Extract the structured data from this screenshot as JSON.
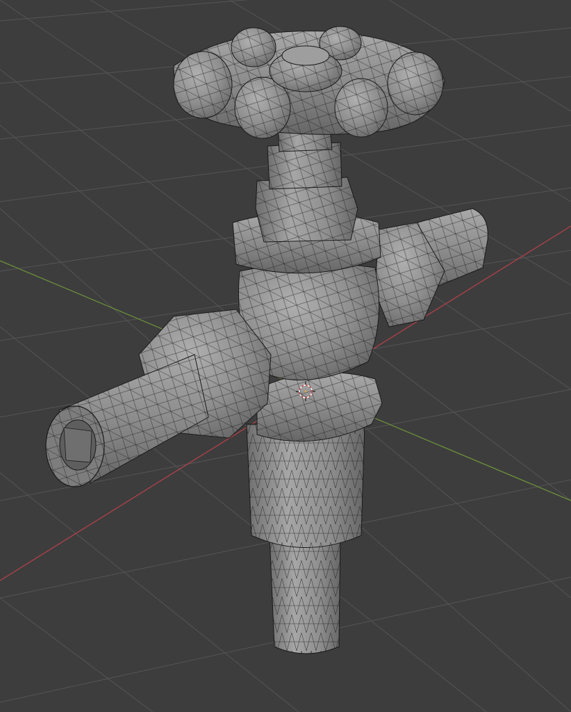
{
  "viewport": {
    "mode": "solid-wireframe",
    "model": "valve-mesh",
    "colors": {
      "background": "#3d3d3d",
      "grid": "#555555",
      "axis_x": "#b3414a",
      "axis_y": "#6c8f3b",
      "mesh_fill": "#8f8f8f",
      "mesh_light": "#a9a9a9",
      "mesh_dark": "#6e6e6e",
      "wire": "#1a1a1a"
    },
    "icons": {
      "origin": "3d-cursor-icon"
    }
  }
}
